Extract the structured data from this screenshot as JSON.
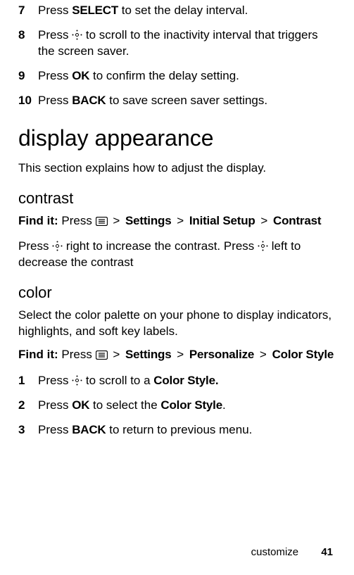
{
  "steps_top": [
    {
      "num": "7",
      "pre": "Press ",
      "btn": "SELECT",
      "post": " to set the delay interval."
    },
    {
      "num": "8",
      "pre": "Press ",
      "nav": true,
      "post": " to scroll to the inactivity interval that triggers the screen saver."
    },
    {
      "num": "9",
      "pre": "Press ",
      "btn": "OK",
      "post": " to confirm the delay setting."
    },
    {
      "num": "10",
      "pre": "Press ",
      "btn": "BACK",
      "post": " to save screen saver settings."
    }
  ],
  "h1": "display appearance",
  "intro": "This section explains how to adjust the display.",
  "contrast": {
    "h2": "contrast",
    "findit_label": "Find it:",
    "findit_press": "Press ",
    "path": [
      "Settings",
      "Initial Setup",
      "Contrast"
    ],
    "body_pre1": "Press ",
    "body_mid1": " right to increase the contrast. Press ",
    "body_post1": " left to decrease the contrast"
  },
  "color": {
    "h2": "color",
    "lead": "Select the color palette on your phone to display indicators, highlights, and soft key labels.",
    "findit_label": "Find it:",
    "findit_press": "Press ",
    "path": [
      "Settings",
      "Personalize",
      "Color Style"
    ],
    "steps": [
      {
        "num": "1",
        "pre": "Press ",
        "nav": true,
        "post1": " to scroll to a ",
        "btn": "Color Style.",
        "post2": ""
      },
      {
        "num": "2",
        "pre": "Press ",
        "btn": "OK",
        "post1": " to select the ",
        "btn2": "Color Style",
        "post2": "."
      },
      {
        "num": "3",
        "pre": "Press ",
        "btn": "BACK",
        "post1": " to return to previous menu.",
        "btn2": "",
        "post2": ""
      }
    ]
  },
  "footer": {
    "section": "customize",
    "page": "41"
  },
  "gt": ">"
}
